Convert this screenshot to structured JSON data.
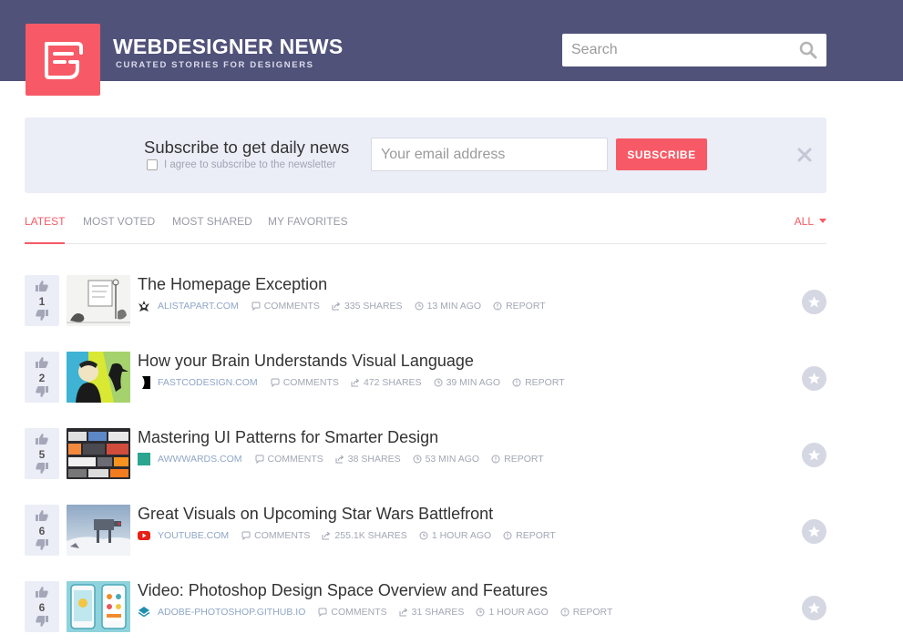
{
  "header": {
    "brand": "WEBDESIGNER NEWS",
    "tagline": "CURATED STORIES FOR DESIGNERS",
    "search_placeholder": "Search",
    "logo_icon": "wdn-logo-icon",
    "search_icon": "search-icon"
  },
  "subscribe": {
    "title": "Subscribe to get daily news",
    "agree_label": "I agree to subscribe to the newsletter",
    "email_placeholder": "Your email address",
    "button_label": "SUBSCRIBE",
    "close_icon": "close-icon"
  },
  "tabs": {
    "latest": "LATEST",
    "most_voted": "MOST VOTED",
    "most_shared": "MOST SHARED",
    "my_favorites": "MY FAVORITES",
    "filter": "ALL",
    "active": "LATEST"
  },
  "stories": [
    {
      "votes": "1",
      "title": "The Homepage Exception",
      "source": "ALISTAPART.COM",
      "comments": "COMMENTS",
      "shares": "335 SHARES",
      "time": "13 MIN AGO",
      "report": "REPORT"
    },
    {
      "votes": "2",
      "title": "How your Brain Understands Visual Language",
      "source": "FASTCODESIGN.COM",
      "comments": "COMMENTS",
      "shares": "472 SHARES",
      "time": "39 MIN AGO",
      "report": "REPORT"
    },
    {
      "votes": "5",
      "title": "Mastering UI Patterns for Smarter Design",
      "source": "AWWWARDS.COM",
      "comments": "COMMENTS",
      "shares": "38 SHARES",
      "time": "53 MIN AGO",
      "report": "REPORT"
    },
    {
      "votes": "6",
      "title": "Great Visuals on Upcoming Star Wars Battlefront",
      "source": "YOUTUBE.COM",
      "comments": "COMMENTS",
      "shares": "255.1K SHARES",
      "time": "1 HOUR AGO",
      "report": "REPORT"
    },
    {
      "votes": "6",
      "title": "Video: Photoshop Design Space Overview and Features",
      "source": "ADOBE-PHOTOSHOP.GITHUB.IO",
      "comments": "COMMENTS",
      "shares": "31 SHARES",
      "time": "1 HOUR AGO",
      "report": "REPORT"
    }
  ],
  "colors": {
    "header_bg": "#51527a",
    "accent": "#f75a66",
    "panel_bg": "#ebedf7",
    "link": "#8fa6c7"
  }
}
